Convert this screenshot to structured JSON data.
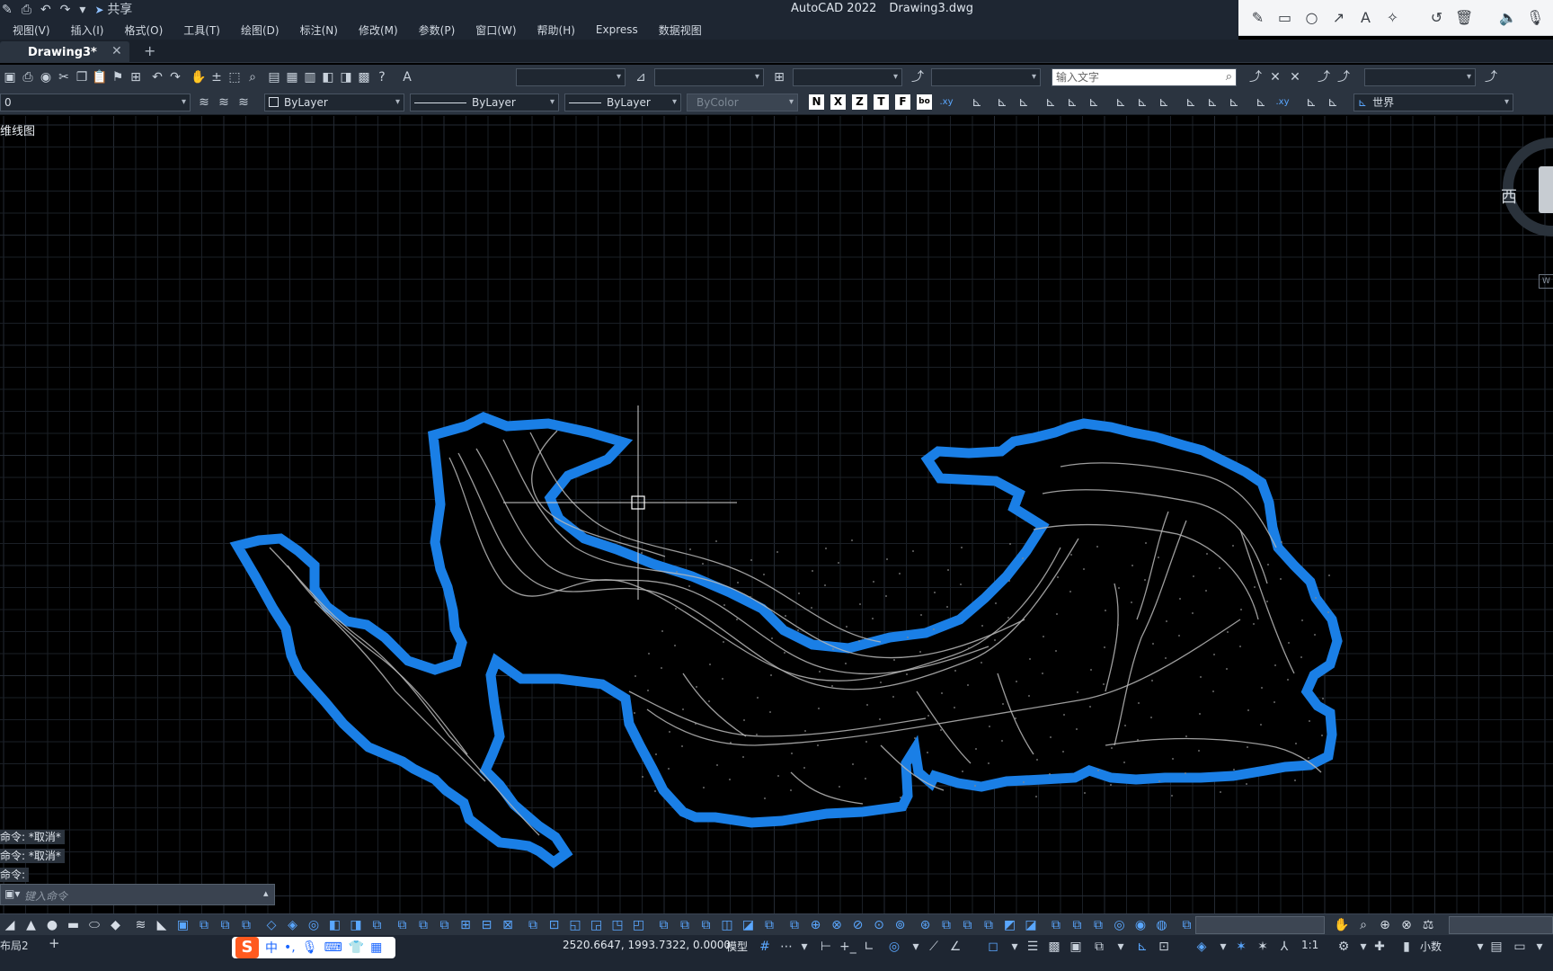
{
  "app": {
    "title": "AutoCAD 2022",
    "document": "Drawing3.dwg"
  },
  "quick_access": {
    "share_label": "共享"
  },
  "menu": [
    "视图(V)",
    "插入(I)",
    "格式(O)",
    "工具(T)",
    "绘图(D)",
    "标注(N)",
    "修改(M)",
    "参数(P)",
    "窗口(W)",
    "帮助(H)",
    "Express",
    "数据视图"
  ],
  "file_tab": {
    "name": "Drawing3*",
    "close": "✕",
    "add": "+"
  },
  "toolbar": {
    "search_placeholder": "输入文字",
    "layer_value": "0",
    "color_value": "ByLayer",
    "linetype_value": "ByLayer",
    "lineweight_value": "ByLayer",
    "plotstyle_value": "ByColor",
    "ucs_value": "世界",
    "text_styles": [
      "N",
      "X",
      "Z",
      "T",
      "F",
      "bo"
    ],
    "xy_label": ".xy"
  },
  "viewport": {
    "label": "维线图",
    "viewcube_west": "西",
    "wcs_label": "W"
  },
  "command_history": [
    "命令: *取消*",
    "命令: *取消*",
    "命令:"
  ],
  "command_input": {
    "placeholder": "键入命令"
  },
  "layout_tab": "布局2",
  "layout_add": "+",
  "status": {
    "coordinates": "2520.6647, 1993.7322, 0.0000",
    "model": "模型",
    "scale": "1:1",
    "units": "小数"
  },
  "ime": {
    "logo": "S",
    "mode": "中"
  },
  "colors": {
    "boundary": "#1a7fe6",
    "contour": "#b8b8b8",
    "grid": "#1a1f26",
    "grid_major": "#242a33",
    "ui_dark": "#2b3440",
    "accent": "#5aa7ff"
  }
}
